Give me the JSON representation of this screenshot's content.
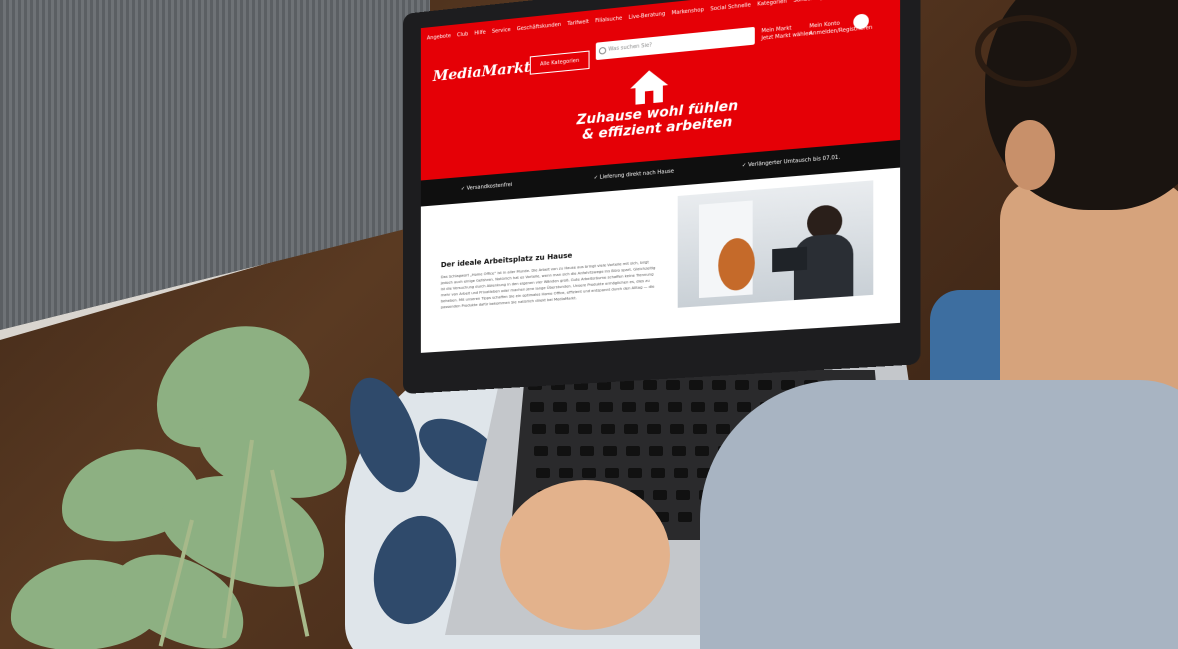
{
  "nav_links": [
    "Angebote",
    "Club",
    "Hilfe",
    "Service",
    "Geschäftskunden",
    "Tarifwelt",
    "Filialsuche",
    "Live-Beratung",
    "Markenshop",
    "Social Schnelle",
    "Kategorien",
    "Sonderangebote"
  ],
  "logo": "MediaMarkt",
  "categories_button": "Alle Kategorien",
  "search_placeholder": "Was suchen Sie?",
  "account_line1": "Mein Markt",
  "account_line2": "Jetzt Markt wählen",
  "login_line1": "Mein Konto",
  "login_line2": "Anmelden/Registrieren",
  "hero_title_1": "Zuhause wohl fühlen",
  "hero_title_2": "& effizient arbeiten",
  "benefits": [
    "✓ Versandkostenfrei",
    "✓ Lieferung direkt nach Hause",
    "✓ Verlängerter Umtausch bis 07.01."
  ],
  "content_title": "Der ideale Arbeitsplatz zu Hause",
  "content_text": "Das Schlagwort „Home Office“ ist in aller Munde. Die Arbeit von zu Hause aus bringt viele Vorteile mit sich, birgt jedoch auch einige Gefahren. Natürlich hat es Vorteile, wenn man sich die Anfahrtswege ins Büro spart. Gleichzeitig ist die Versuchung durch Ablenkung in den eigenen vier Wänden groß. Gute Arbeitsräume schaffen keine Trennung mehr von Arbeit und Privatleben oder machen jene lange Überstunden. Unsere Produkte ermöglichen es, dies zu beheben. Mit unseren Tipps schaffen Sie ein optimales Home Office, effizient und entspannt durch den Alltag — die passenden Produkte dafür bekommen Sie natürlich direkt bei MediaMarkt.",
  "colors": {
    "brand_red": "#e50006",
    "benefits_bar": "#0f0f0f"
  },
  "icons": [
    "house-icon",
    "search-icon",
    "cart-icon",
    "grid-icon"
  ]
}
